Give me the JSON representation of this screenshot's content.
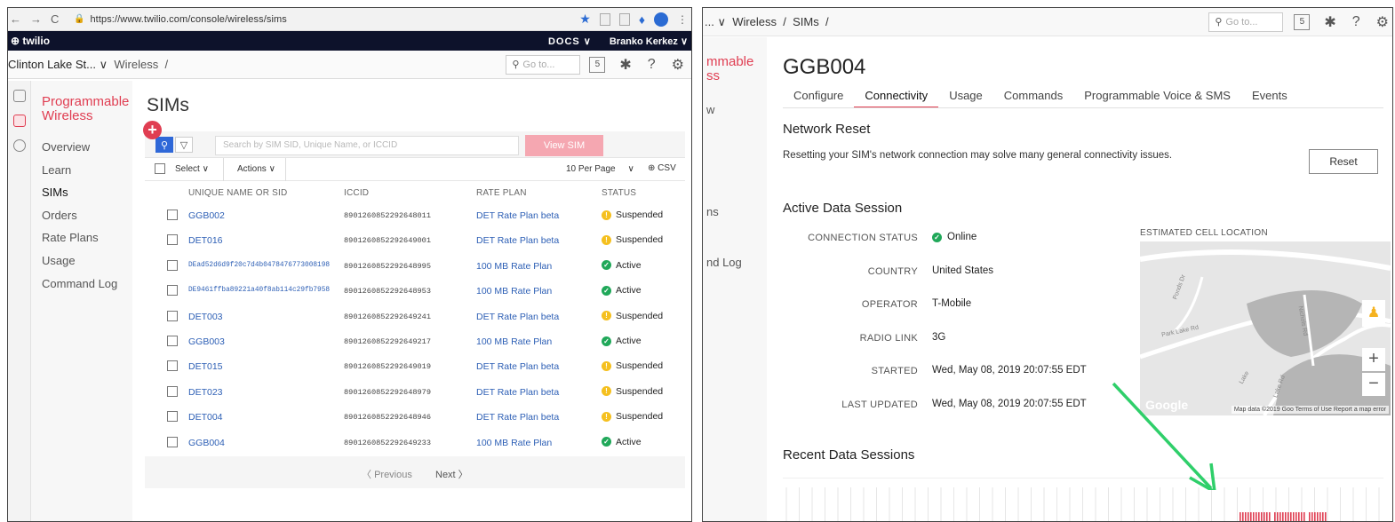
{
  "left": {
    "browser": {
      "url": "https://www.twilio.com/console/wireless/sims"
    },
    "topbar": {
      "logo": "twilio",
      "docs": "DOCS",
      "user": "Branko Kerkez"
    },
    "breadcrumb": {
      "account": "Clinton Lake St...",
      "section": "Wireless",
      "sep": "/"
    },
    "goto_placeholder": "Go to...",
    "kbd_label": "5",
    "sidebar": {
      "product": "Programmable Wireless",
      "items": [
        "Overview",
        "Learn",
        "SIMs",
        "Orders",
        "Rate Plans",
        "Usage",
        "Command Log"
      ],
      "active": "SIMs"
    },
    "page_title": "SIMs",
    "search_placeholder": "Search by SIM SID, Unique Name, or ICCID",
    "view_sim": "View SIM",
    "toolbar": {
      "select": "Select",
      "actions": "Actions",
      "per_page": "10 Per Page",
      "csv": "CSV"
    },
    "columns": {
      "name": "UNIQUE NAME OR SID",
      "iccid": "ICCID",
      "plan": "RATE PLAN",
      "status": "STATUS"
    },
    "rows": [
      {
        "name": "GGB002",
        "iccid": "8901260852292648011",
        "plan": "DET Rate Plan beta",
        "status": "Suspended"
      },
      {
        "name": "DET016",
        "iccid": "8901260852292649001",
        "plan": "DET Rate Plan beta",
        "status": "Suspended"
      },
      {
        "name": "DEad52d6d9f20c7d4b0478476773008198",
        "iccid": "8901260852292648995",
        "plan": "100 MB Rate Plan",
        "status": "Active",
        "mono": true
      },
      {
        "name": "DE9461ffba89221a40f8ab114c29fb7958",
        "iccid": "8901260852292648953",
        "plan": "100 MB Rate Plan",
        "status": "Active",
        "mono": true
      },
      {
        "name": "DET003",
        "iccid": "8901260852292649241",
        "plan": "DET Rate Plan beta",
        "status": "Suspended"
      },
      {
        "name": "GGB003",
        "iccid": "8901260852292649217",
        "plan": "100 MB Rate Plan",
        "status": "Active"
      },
      {
        "name": "DET015",
        "iccid": "8901260852292649019",
        "plan": "DET Rate Plan beta",
        "status": "Suspended"
      },
      {
        "name": "DET023",
        "iccid": "8901260852292648979",
        "plan": "DET Rate Plan beta",
        "status": "Suspended"
      },
      {
        "name": "DET004",
        "iccid": "8901260852292648946",
        "plan": "DET Rate Plan beta",
        "status": "Suspended"
      },
      {
        "name": "GGB004",
        "iccid": "8901260852292649233",
        "plan": "100 MB Rate Plan",
        "status": "Active"
      }
    ],
    "pager": {
      "prev": "Previous",
      "next": "Next"
    }
  },
  "right": {
    "breadcrumb": {
      "section": "Wireless",
      "sep": "/"
    },
    "goto_placeholder": "Go to...",
    "kbd_label": "5",
    "sidebar_fragments": [
      "mmable",
      "ss",
      "w",
      "ns",
      "nd Log"
    ],
    "sim_name": "GGB004",
    "tabs": [
      "Configure",
      "Connectivity",
      "Usage",
      "Commands",
      "Programmable Voice & SMS",
      "Events"
    ],
    "active_tab": "Connectivity",
    "network_reset": {
      "title": "Network Reset",
      "description": "Resetting your SIM's network connection may solve many general connectivity issues.",
      "button": "Reset"
    },
    "active_session": {
      "title": "Active Data Session",
      "fields": [
        {
          "key": "CONNECTION STATUS",
          "value": "Online"
        },
        {
          "key": "COUNTRY",
          "value": "United States"
        },
        {
          "key": "OPERATOR",
          "value": "T-Mobile"
        },
        {
          "key": "RADIO LINK",
          "value": "3G"
        },
        {
          "key": "STARTED",
          "value": "Wed, May 08, 2019 20:07:55 EDT"
        },
        {
          "key": "LAST UPDATED",
          "value": "Wed, May 08, 2019 20:07:55 EDT"
        }
      ]
    },
    "map": {
      "label": "ESTIMATED CELL LOCATION",
      "road1": "Park Lake Rd",
      "road2": "Lake Rd",
      "road3": "Nichols Rd",
      "road4": "Lake",
      "road5": "Ponds Dr",
      "brand": "Google",
      "attribution": "Map data ©2019 Goo Terms of Use   Report a map error"
    },
    "recent_sessions": {
      "title": "Recent Data Sessions"
    },
    "colors": {
      "accent": "#e03e52",
      "link": "#2d5fb5",
      "arrow": "#2fcf6a"
    }
  }
}
